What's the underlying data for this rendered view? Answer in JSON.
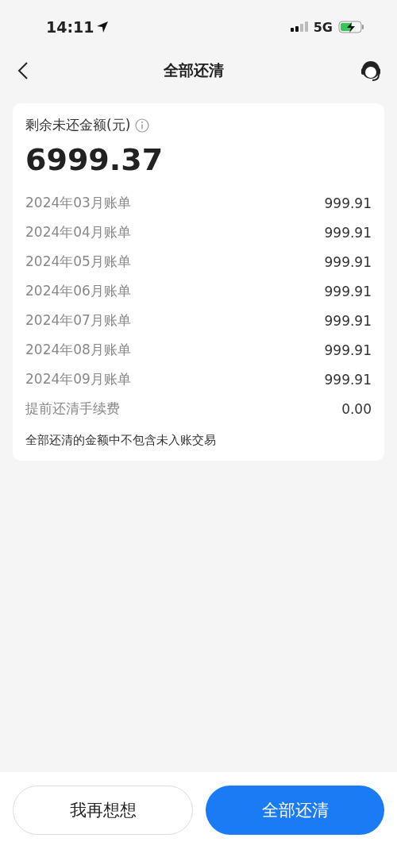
{
  "status_bar": {
    "time": "14:11",
    "network": "5G"
  },
  "nav": {
    "title": "全部还清"
  },
  "summary": {
    "label": "剩余未还金额(元)",
    "amount": "6999.37",
    "rows": [
      {
        "label": "2024年03月账单",
        "value": "999.91"
      },
      {
        "label": "2024年04月账单",
        "value": "999.91"
      },
      {
        "label": "2024年05月账单",
        "value": "999.91"
      },
      {
        "label": "2024年06月账单",
        "value": "999.91"
      },
      {
        "label": "2024年07月账单",
        "value": "999.91"
      },
      {
        "label": "2024年08月账单",
        "value": "999.91"
      },
      {
        "label": "2024年09月账单",
        "value": "999.91"
      },
      {
        "label": "提前还清手续费",
        "value": "0.00"
      }
    ],
    "note": "全部还清的金额中不包含未入账交易"
  },
  "buttons": [
    {
      "label": "我再想想",
      "kind": "secondary"
    },
    {
      "label": "全部还清",
      "kind": "primary"
    }
  ]
}
